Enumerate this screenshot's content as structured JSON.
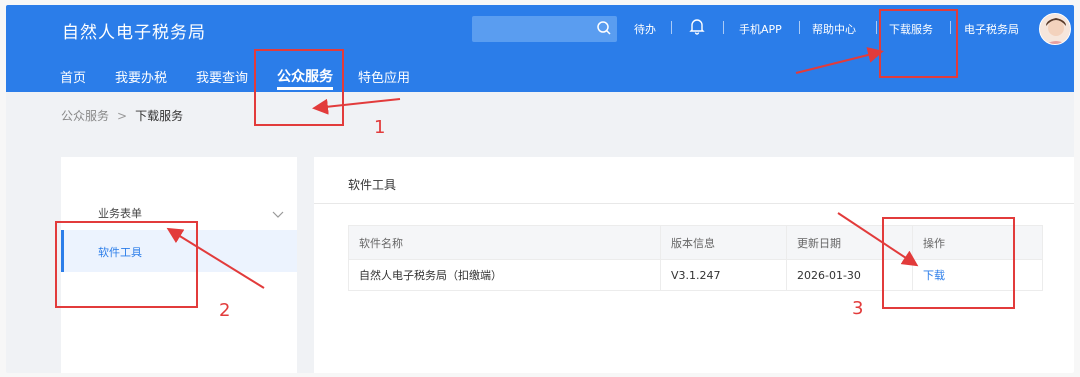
{
  "header": {
    "app_title": "自然人电子税务局",
    "links": [
      "待办",
      "手机APP",
      "帮助中心",
      "下载服务",
      "电子税务局"
    ]
  },
  "nav": {
    "items": [
      "首页",
      "我要办税",
      "我要查询",
      "公众服务",
      "特色应用"
    ],
    "active_index": 3
  },
  "breadcrumb": {
    "parent": "公众服务",
    "separator": ">",
    "current": "下载服务"
  },
  "sidebar": {
    "group_label": "业务表单",
    "active_item": "软件工具"
  },
  "main": {
    "title": "软件工具",
    "table": {
      "headers": [
        "软件名称",
        "版本信息",
        "更新日期",
        "操作"
      ],
      "rows": [
        {
          "name": "自然人电子税务局（扣缴端）",
          "version": "V3.1.247",
          "date": "2026-01-30",
          "action": "下载"
        }
      ]
    }
  },
  "annotations": {
    "labels": [
      "1",
      "2",
      "3"
    ],
    "color": "#e23b3b"
  },
  "colors": {
    "brand": "#2b7de9",
    "page_bg": "#f0f2f5"
  },
  "icons": {
    "search": "search-icon",
    "bell": "bell-icon",
    "chevron": "chevron-down-icon",
    "avatar": "avatar"
  }
}
